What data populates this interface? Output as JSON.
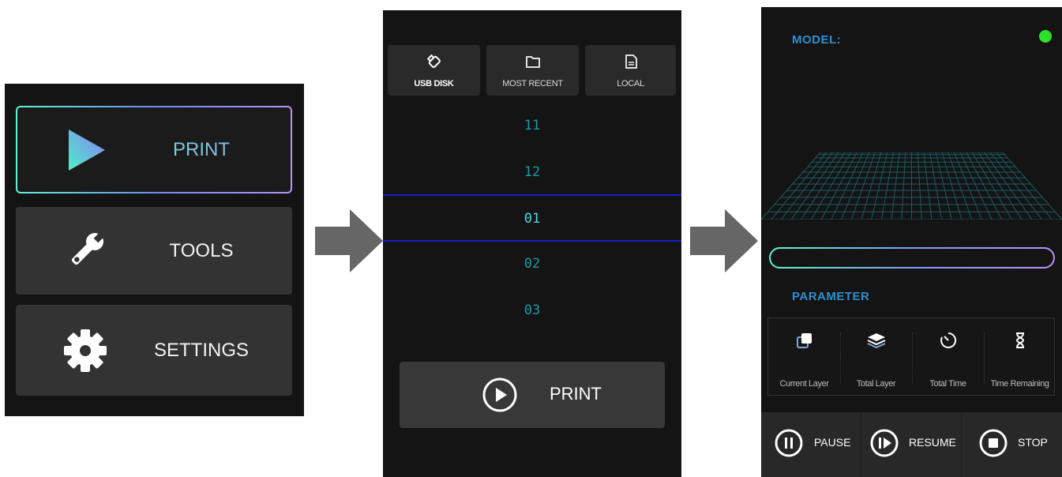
{
  "menu": {
    "print_label": "PRINT",
    "tools_label": "TOOLS",
    "settings_label": "SETTINGS",
    "icons": [
      "play-icon",
      "wrench-icon",
      "gear-icon"
    ]
  },
  "files": {
    "tabs": [
      {
        "label": "USB DISK",
        "icon": "usb-icon"
      },
      {
        "label": "MOST RECENT",
        "icon": "folder-icon"
      },
      {
        "label": "LOCAL",
        "icon": "file-icon"
      }
    ],
    "items": [
      "11",
      "12",
      "01",
      "02",
      "03"
    ],
    "selected": "01",
    "print_label": "PRINT"
  },
  "printing": {
    "model_label": "MODEL:",
    "status_color": "#2ee02a",
    "parameter_label": "PARAMETER",
    "params": [
      {
        "label": "Current Layer",
        "icon": "layer-copy-icon"
      },
      {
        "label": "Total Layer",
        "icon": "layers-stack-icon"
      },
      {
        "label": "Total Time",
        "icon": "timer-icon"
      },
      {
        "label": "Time Remaining",
        "icon": "hourglass-icon"
      }
    ],
    "controls": [
      {
        "label": "PAUSE",
        "icon": "pause-icon"
      },
      {
        "label": "RESUME",
        "icon": "resume-icon"
      },
      {
        "label": "STOP",
        "icon": "stop-icon"
      }
    ]
  },
  "colors": {
    "accent_gradient_start": "#5ff5d1",
    "accent_gradient_end": "#b794f6",
    "file_text": "#1a9aa6",
    "section_title": "#2f8fd1"
  }
}
